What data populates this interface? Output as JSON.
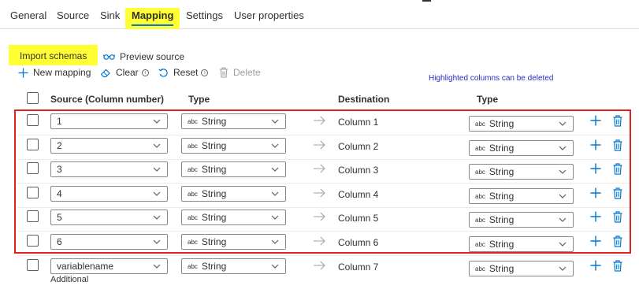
{
  "tabs": [
    {
      "label": "General"
    },
    {
      "label": "Source"
    },
    {
      "label": "Sink"
    },
    {
      "label": "Mapping",
      "active": true
    },
    {
      "label": "Settings"
    },
    {
      "label": "User properties"
    }
  ],
  "toolbar": {
    "import_label": "Import schemas",
    "preview_label": "Preview source",
    "new_mapping_label": "New mapping",
    "clear_label": "Clear",
    "reset_label": "Reset",
    "delete_label": "Delete"
  },
  "hint_text": "Highlighted columns can be deleted",
  "info_glyph": "i",
  "headers": {
    "source": "Source (Column number)",
    "source_type": "Type",
    "destination": "Destination",
    "dest_type": "Type"
  },
  "type_prefix": "abc",
  "rows": [
    {
      "source": "1",
      "source_type": "String",
      "destination": "Column 1",
      "dest_type": "String"
    },
    {
      "source": "2",
      "source_type": "String",
      "destination": "Column 2",
      "dest_type": "String"
    },
    {
      "source": "3",
      "source_type": "String",
      "destination": "Column 3",
      "dest_type": "String"
    },
    {
      "source": "4",
      "source_type": "String",
      "destination": "Column 4",
      "dest_type": "String"
    },
    {
      "source": "5",
      "source_type": "String",
      "destination": "Column 5",
      "dest_type": "String"
    },
    {
      "source": "6",
      "source_type": "String",
      "destination": "Column 6",
      "dest_type": "String"
    },
    {
      "source": "variablename",
      "source_type": "String",
      "destination": "Column 7",
      "dest_type": "String"
    }
  ],
  "additional_label": "Additional",
  "colors": {
    "accent": "#0078d4",
    "highlight": "#ffff33",
    "border_red": "#e0211d",
    "hint_blue": "#2b2bbf"
  }
}
